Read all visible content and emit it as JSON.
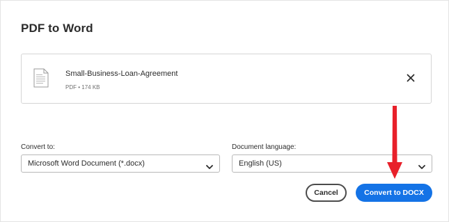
{
  "dialog": {
    "title": "PDF to Word"
  },
  "file": {
    "name": "Small-Business-Loan-Agreement",
    "meta": "PDF • 174 KB",
    "icon": "pdf-file-icon",
    "remove_icon": "close-icon"
  },
  "convert_to": {
    "label": "Convert to:",
    "selected": "Microsoft Word Document (*.docx)"
  },
  "language": {
    "label": "Document language:",
    "selected": "English (US)"
  },
  "actions": {
    "cancel_label": "Cancel",
    "convert_label": "Convert to DOCX"
  },
  "colors": {
    "primary": "#1473e6",
    "annotation": "#e8202a"
  }
}
